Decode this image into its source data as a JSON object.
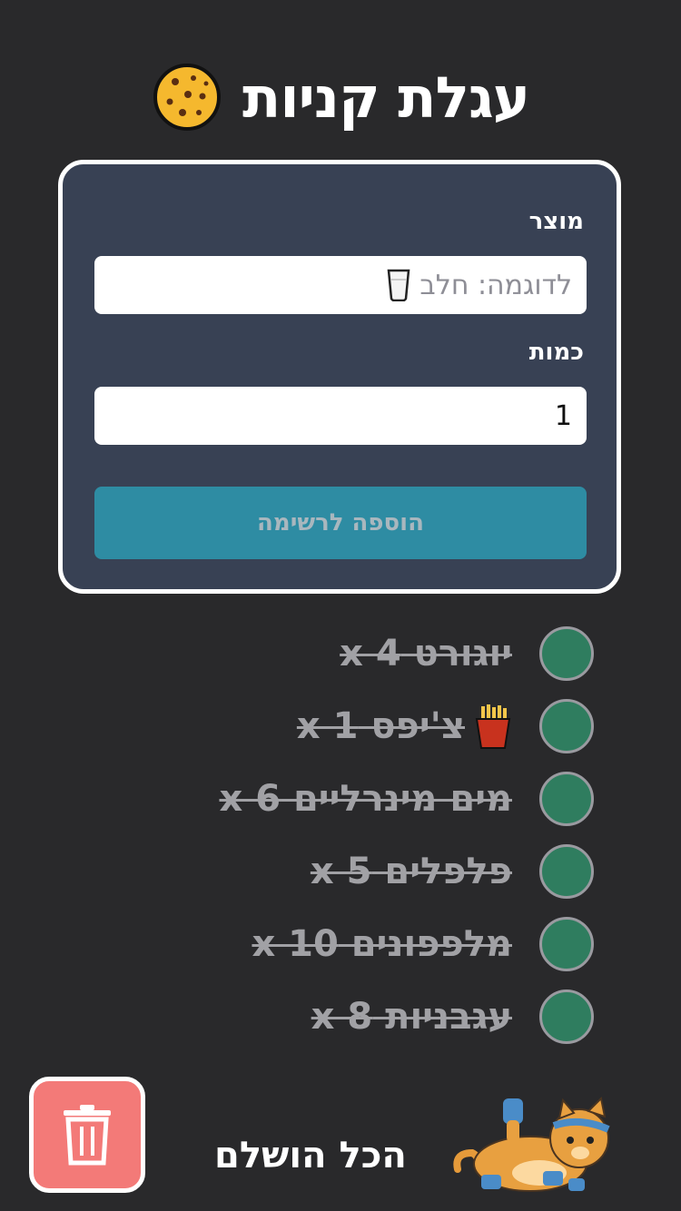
{
  "header": {
    "title": "עגלת קניות",
    "icon": "cookie-icon"
  },
  "form": {
    "product_label": "מוצר",
    "product_placeholder": "לדוגמה: חלב",
    "quantity_label": "כמות",
    "quantity_value": "1",
    "add_button": "הוספה לרשימה"
  },
  "items": [
    {
      "text": "יוגורט x 4",
      "checked": true
    },
    {
      "text": "צ'יפס x 1",
      "checked": true,
      "icon": "fries-icon"
    },
    {
      "text": "מים מינרליים x 6",
      "checked": true
    },
    {
      "text": "פלפלים x 5",
      "checked": true
    },
    {
      "text": "מלפפונים x 10",
      "checked": true
    },
    {
      "text": "עגבניות x 8",
      "checked": true
    }
  ],
  "footer": {
    "done_text": "הכל הושלם",
    "trash_icon": "trash-icon",
    "illustration": "cat-illustration"
  },
  "colors": {
    "background": "#29292b",
    "card": "#384154",
    "button": "#2e8ca3",
    "check": "#2f7d5f",
    "trash": "#f37a78"
  }
}
